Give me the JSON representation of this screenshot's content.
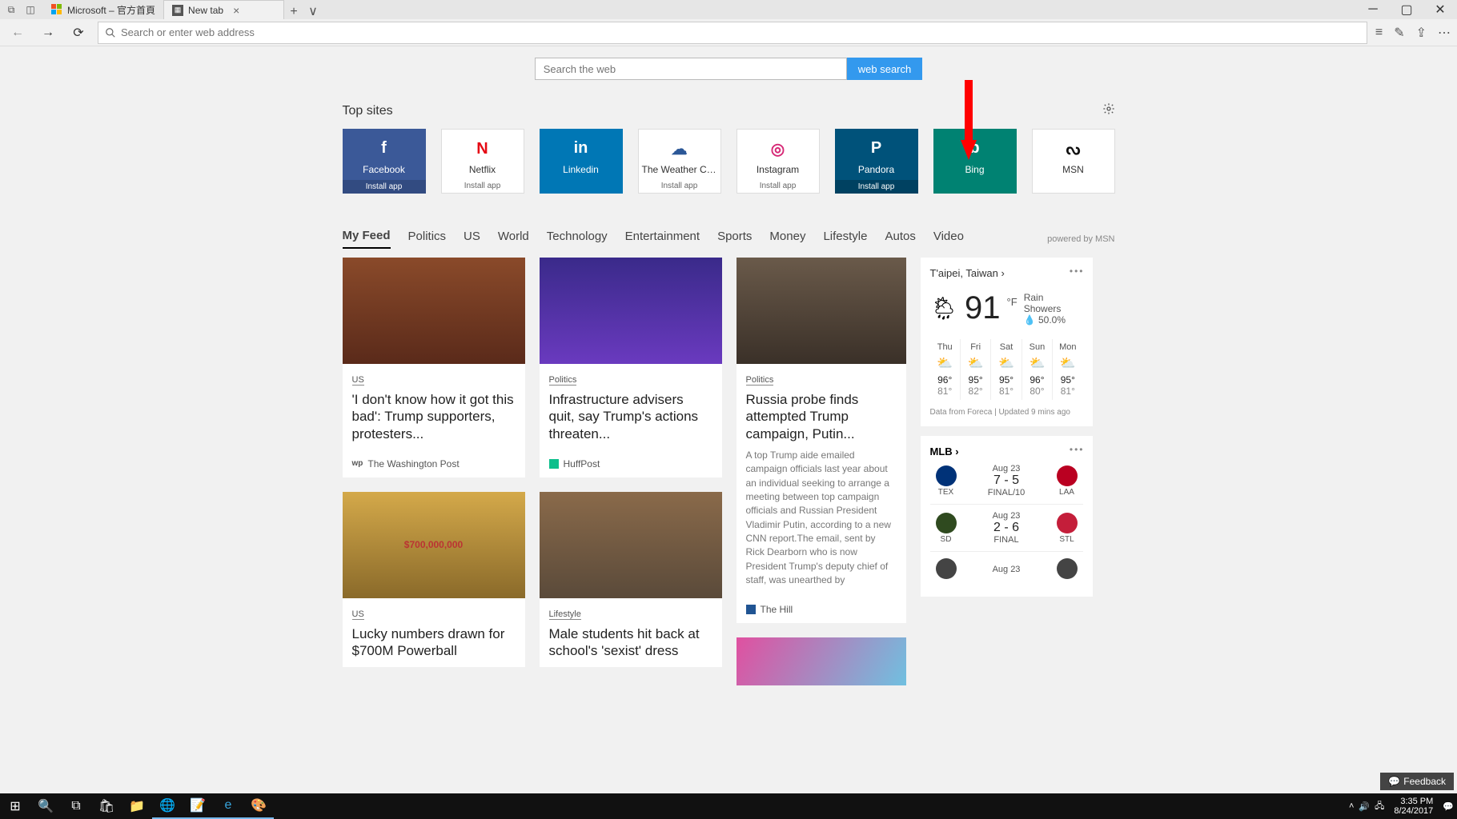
{
  "titlebar": {
    "tabs": [
      {
        "label": "Microsoft – 官方首頁",
        "active": false
      },
      {
        "label": "New tab",
        "active": true
      }
    ]
  },
  "toolbar": {
    "address_placeholder": "Search or enter web address"
  },
  "search": {
    "placeholder": "Search the web",
    "button": "web search"
  },
  "topsites": {
    "heading": "Top sites",
    "install": "Install app",
    "items": [
      {
        "name": "Facebook",
        "cls": "fb",
        "install": true,
        "icon": "f"
      },
      {
        "name": "Netflix",
        "cls": "white",
        "install": true,
        "icon": "N",
        "color": "#e50914"
      },
      {
        "name": "Linkedin",
        "cls": "li",
        "install": false,
        "icon": "in"
      },
      {
        "name": "The Weather Cha...",
        "cls": "white",
        "install": true,
        "icon": "☁",
        "color": "#2b5797"
      },
      {
        "name": "Instagram",
        "cls": "white",
        "install": true,
        "icon": "◎",
        "color": "#d62976"
      },
      {
        "name": "Pandora",
        "cls": "pd",
        "install": true,
        "icon": "P"
      },
      {
        "name": "Bing",
        "cls": "bg",
        "install": false,
        "icon": "b"
      },
      {
        "name": "MSN",
        "cls": "white noinstall",
        "install": false,
        "icon": "ᔓ",
        "color": "#111"
      }
    ]
  },
  "feed": {
    "tabs": [
      "My Feed",
      "Politics",
      "US",
      "World",
      "Technology",
      "Entertainment",
      "Sports",
      "Money",
      "Lifestyle",
      "Autos",
      "Video"
    ],
    "active": 0,
    "powered": "powered by MSN",
    "cards": {
      "c1": {
        "cat": "US",
        "title": "'I don't know how it got this bad': Trump supporters, protesters...",
        "src": "The Washington Post",
        "srcIcon": "wp"
      },
      "c2": {
        "cat": "US",
        "title": "Lucky numbers drawn for $700M Powerball"
      },
      "c3": {
        "cat": "Politics",
        "title": "Infrastructure advisers quit, say Trump's actions threaten...",
        "src": "HuffPost"
      },
      "c4": {
        "cat": "Lifestyle",
        "title": "Male students hit back at school's 'sexist' dress"
      },
      "c5": {
        "cat": "Politics",
        "title": "Russia probe finds attempted Trump campaign, Putin...",
        "desc": "A top Trump aide emailed campaign officials last year about an individual seeking to arrange a meeting between top campaign officials and Russian President Vladimir Putin, according to a new CNN report.The email, sent by Rick Dearborn who is now President Trump's deputy chief of staff, was unearthed by",
        "src": "The Hill"
      }
    }
  },
  "weather": {
    "location": "T'aipei, Taiwan",
    "temp": "91",
    "unit": "°F",
    "condition": "Rain Showers",
    "precip": "50.0%",
    "days": [
      {
        "d": "Thu",
        "hi": "96°",
        "lo": "81°"
      },
      {
        "d": "Fri",
        "hi": "95°",
        "lo": "82°"
      },
      {
        "d": "Sat",
        "hi": "95°",
        "lo": "81°"
      },
      {
        "d": "Sun",
        "hi": "96°",
        "lo": "80°"
      },
      {
        "d": "Mon",
        "hi": "95°",
        "lo": "81°"
      }
    ],
    "foot": "Data from Foreca | Updated 9 mins ago"
  },
  "mlb": {
    "label": "MLB",
    "games": [
      {
        "date": "Aug 23",
        "score": "7 - 5",
        "status": "FINAL/10",
        "a": "TEX",
        "ac": "#003278",
        "b": "LAA",
        "bc": "#ba0021"
      },
      {
        "date": "Aug 23",
        "score": "2 - 6",
        "status": "FINAL",
        "a": "SD",
        "ac": "#2f4a1f",
        "b": "STL",
        "bc": "#c41e3a"
      },
      {
        "date": "Aug 23",
        "score": "",
        "status": "",
        "a": "",
        "ac": "#444",
        "b": "",
        "bc": "#444"
      }
    ]
  },
  "feedback": "Feedback",
  "tray": {
    "time": "3:35 PM",
    "date": "8/24/2017"
  }
}
